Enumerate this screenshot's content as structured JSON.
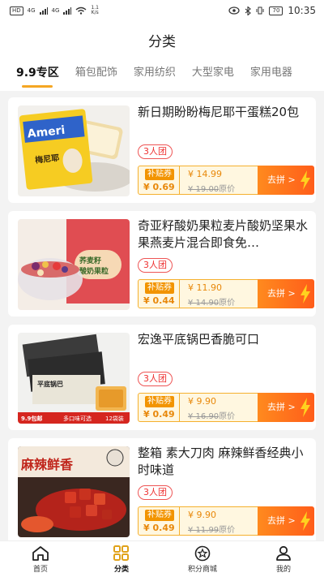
{
  "status": {
    "left_icons": [
      "HD",
      "4G",
      "4G",
      "wifi"
    ],
    "speed_value": "1.1",
    "speed_unit": "K/s",
    "battery": "70",
    "time": "10:35"
  },
  "page_title": "分类",
  "tabs": [
    {
      "label": "9.9专区",
      "active": true
    },
    {
      "label": "箱包配饰",
      "active": false
    },
    {
      "label": "家用纺织",
      "active": false
    },
    {
      "label": "大型家电",
      "active": false
    },
    {
      "label": "家用电器",
      "active": false
    }
  ],
  "products": [
    {
      "title": "新日期盼盼梅尼耶干蛋糕20包",
      "group": "3人团",
      "subsidy_tag": "补贴券",
      "subsidy": "¥ 0.69",
      "price": "¥ 14.99",
      "orig_price": "¥ 19.00",
      "orig_suffix": "原价",
      "action": "去拼 >",
      "thumb_text": "Ameri",
      "thumb_sub": "梅尼耶"
    },
    {
      "title": "奇亚籽酸奶果粒麦片酸奶坚果水果燕麦片混合即食免…",
      "group": "3人团",
      "subsidy_tag": "补贴券",
      "subsidy": "¥ 0.44",
      "price": "¥ 11.90",
      "orig_price": "¥ 14.90",
      "orig_suffix": "原价",
      "action": "去拼 >",
      "thumb_text": "荞麦籽",
      "thumb_sub": "酸奶果粒"
    },
    {
      "title": "宏逸平底锅巴香脆可口",
      "group": "3人团",
      "subsidy_tag": "补贴券",
      "subsidy": "¥ 0.49",
      "price": "¥ 9.90",
      "orig_price": "¥ 16.90",
      "orig_suffix": "原价",
      "action": "去拼 >",
      "thumb_text": "平底锅巴",
      "thumb_sub": "多口味可选",
      "thumb_badge": "9.9包邮",
      "thumb_count": "12袋装"
    },
    {
      "title": "整箱 素大刀肉 麻辣鲜香经典小时味道",
      "group": "3人团",
      "subsidy_tag": "补贴券",
      "subsidy": "¥ 0.49",
      "price": "¥ 9.90",
      "orig_price": "¥ 11.99",
      "orig_suffix": "原价",
      "action": "去拼 >",
      "thumb_text": "麻辣鲜香"
    }
  ],
  "bottom_nav": [
    {
      "label": "首页",
      "icon": "home-icon",
      "active": false
    },
    {
      "label": "分类",
      "icon": "grid-icon",
      "active": true
    },
    {
      "label": "积分商城",
      "icon": "star-icon",
      "active": false
    },
    {
      "label": "我的",
      "icon": "person-icon",
      "active": false
    }
  ],
  "colors": {
    "accent": "#f5a623",
    "price": "#e8880a",
    "button": "#ff6a1a",
    "group": "#e33333"
  }
}
